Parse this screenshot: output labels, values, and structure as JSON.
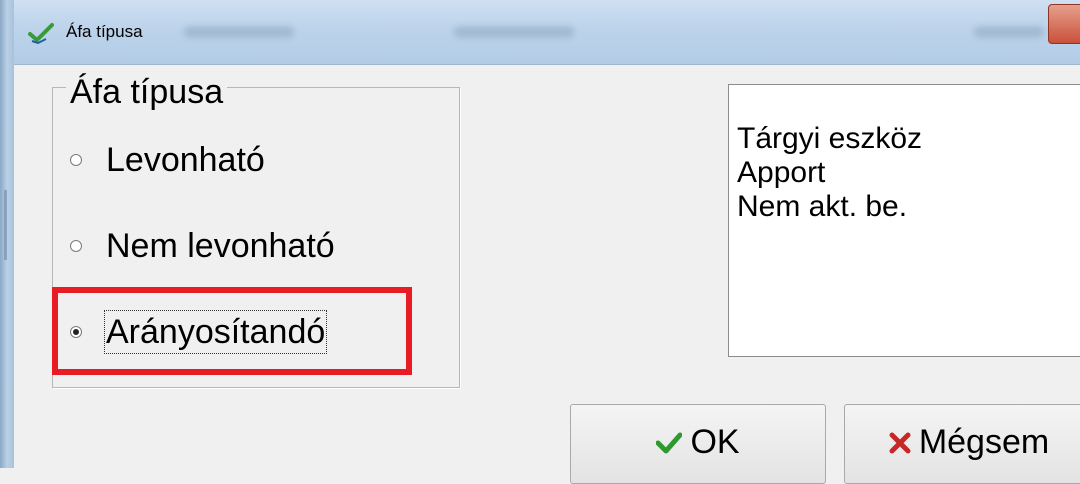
{
  "window": {
    "title": "Áfa típusa",
    "icon": "checkmark-app-icon"
  },
  "group": {
    "legend": "Áfa típusa",
    "options": [
      {
        "label": "Levonható",
        "checked": false
      },
      {
        "label": "Nem levonható",
        "checked": false
      },
      {
        "label": "Arányosítandó",
        "checked": true
      }
    ]
  },
  "list": {
    "items": [
      "Tárgyi eszköz",
      "Apport",
      "Nem akt. be."
    ]
  },
  "buttons": {
    "ok": {
      "label": "OK",
      "icon": "green-checkmark-icon",
      "color": "#2e9a2e"
    },
    "cancel": {
      "label": "Mégsem",
      "icon": "red-x-icon",
      "color": "#c62828"
    }
  },
  "highlight_color": "#e81c24"
}
